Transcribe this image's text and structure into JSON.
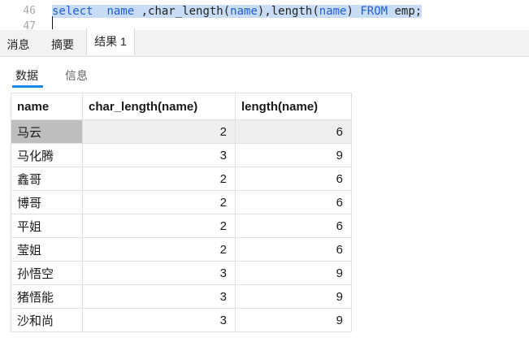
{
  "editor": {
    "line_numbers": [
      "46",
      "47"
    ],
    "sql": {
      "select": "select",
      "gap1": "  ",
      "name": "name",
      "comma1": " ,",
      "char_length": "char_length(",
      "name2": "name",
      "close1": "),",
      "length": "length(",
      "name3": "name",
      "close2": ") ",
      "from": "FROM",
      "rest": " emp;"
    }
  },
  "result_tabs": [
    {
      "label": "消息"
    },
    {
      "label": "摘要"
    },
    {
      "label": "结果 1"
    }
  ],
  "sub_tabs": [
    {
      "label": "数据"
    },
    {
      "label": "信息"
    }
  ],
  "table": {
    "headers": [
      "name",
      "char_length(name)",
      "length(name)"
    ],
    "rows": [
      [
        "马云",
        "2",
        "6"
      ],
      [
        "马化腾",
        "3",
        "9"
      ],
      [
        "鑫哥",
        "2",
        "6"
      ],
      [
        "博哥",
        "2",
        "6"
      ],
      [
        "平姐",
        "2",
        "6"
      ],
      [
        "莹姐",
        "2",
        "6"
      ],
      [
        "孙悟空",
        "3",
        "9"
      ],
      [
        "猪悟能",
        "3",
        "9"
      ],
      [
        "沙和尚",
        "3",
        "9"
      ]
    ]
  },
  "colors": {
    "keyword": "#1f5fd6",
    "selection": "#c9dcf5",
    "active_tab_underline": "#1a87e6",
    "selected_cell": "#bebebe"
  }
}
